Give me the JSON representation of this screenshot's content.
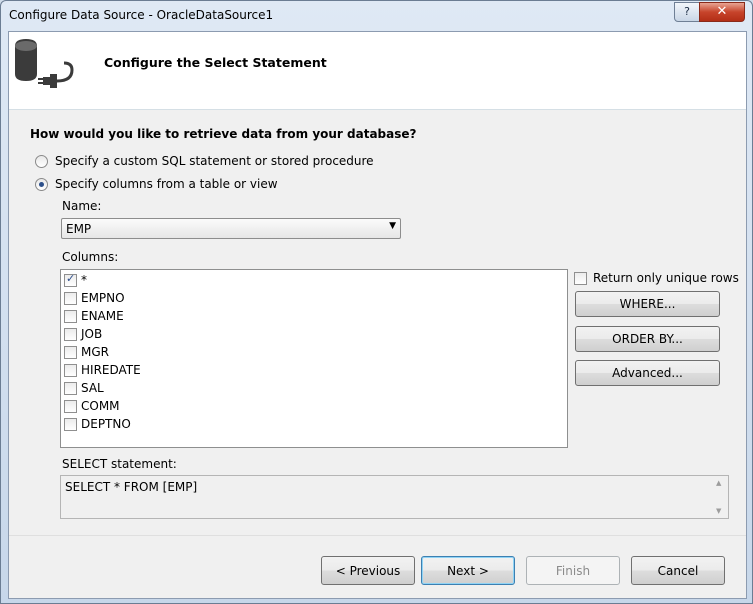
{
  "window": {
    "title": "Configure Data Source - OracleDataSource1",
    "help_label": "?",
    "close_label": "✕"
  },
  "header": {
    "title": "Configure the Select Statement",
    "icon": "database-plug-icon"
  },
  "question": "How would you like to retrieve data from your database?",
  "options": {
    "custom_sql": {
      "label": "Specify a custom SQL statement or stored procedure",
      "selected": false
    },
    "columns": {
      "label": "Specify columns from a table or view",
      "selected": true
    }
  },
  "name_field": {
    "label": "Name:",
    "value": "EMP"
  },
  "columns": {
    "label": "Columns:",
    "items": [
      {
        "label": "*",
        "checked": true
      },
      {
        "label": "EMPNO",
        "checked": false
      },
      {
        "label": "ENAME",
        "checked": false
      },
      {
        "label": "JOB",
        "checked": false
      },
      {
        "label": "MGR",
        "checked": false
      },
      {
        "label": "HIREDATE",
        "checked": false
      },
      {
        "label": "SAL",
        "checked": false
      },
      {
        "label": "COMM",
        "checked": false
      },
      {
        "label": "DEPTNO",
        "checked": false
      }
    ]
  },
  "unique_rows": {
    "label": "Return only unique rows",
    "checked": false
  },
  "side_buttons": {
    "where": "WHERE...",
    "order_by": "ORDER BY...",
    "advanced": "Advanced..."
  },
  "select_statement": {
    "label": "SELECT statement:",
    "value": "SELECT * FROM [EMP]"
  },
  "footer": {
    "previous": "< Previous",
    "next": "Next >",
    "finish": "Finish",
    "cancel": "Cancel"
  }
}
